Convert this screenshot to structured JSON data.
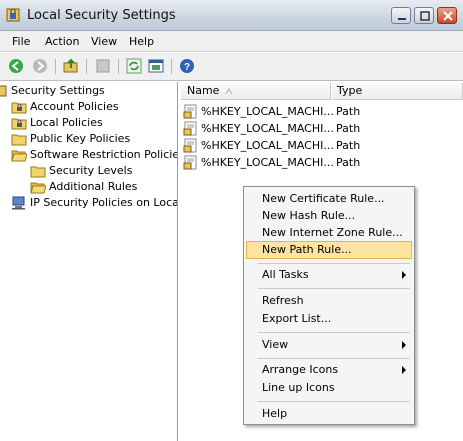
{
  "window": {
    "title": "Local Security Settings"
  },
  "menubar": {
    "items": [
      "File",
      "Action",
      "View",
      "Help"
    ]
  },
  "tree": {
    "items": [
      {
        "label": "Security Settings"
      },
      {
        "label": "Account Policies"
      },
      {
        "label": "Local Policies"
      },
      {
        "label": "Public Key Policies"
      },
      {
        "label": "Software Restriction Policies"
      },
      {
        "label": "Security Levels"
      },
      {
        "label": "Additional Rules"
      },
      {
        "label": "IP Security Policies on Local Co"
      }
    ]
  },
  "list": {
    "columns": [
      {
        "label": "Name"
      },
      {
        "label": "Type"
      }
    ],
    "rows": [
      {
        "name": "%HKEY_LOCAL_MACHI...",
        "type": "Path"
      },
      {
        "name": "%HKEY_LOCAL_MACHI...",
        "type": "Path"
      },
      {
        "name": "%HKEY_LOCAL_MACHI...",
        "type": "Path"
      },
      {
        "name": "%HKEY_LOCAL_MACHI...",
        "type": "Path"
      }
    ]
  },
  "context_menu": {
    "items": [
      {
        "label": "New Certificate Rule..."
      },
      {
        "label": "New Hash Rule..."
      },
      {
        "label": "New Internet Zone Rule..."
      },
      {
        "label": "New Path Rule..."
      },
      {
        "label": "All Tasks"
      },
      {
        "label": "Refresh"
      },
      {
        "label": "Export List..."
      },
      {
        "label": "View"
      },
      {
        "label": "Arrange Icons"
      },
      {
        "label": "Line up Icons"
      },
      {
        "label": "Help"
      }
    ]
  },
  "colors": {
    "highlight": "#fde4a2",
    "titlebar": "#cbd5e1"
  }
}
